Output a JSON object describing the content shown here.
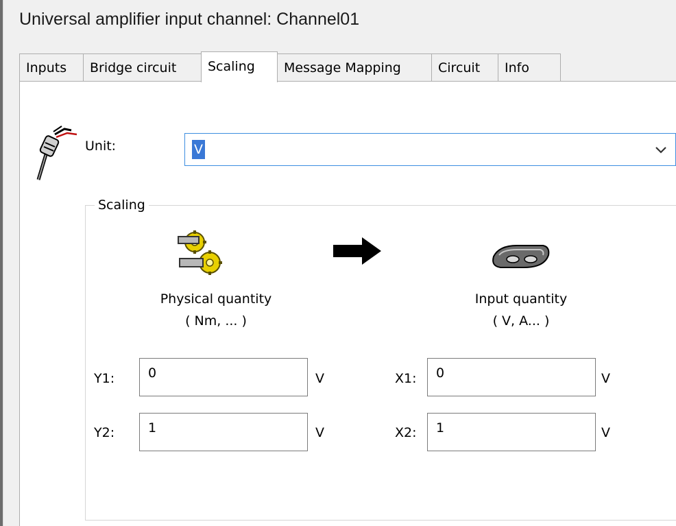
{
  "window": {
    "title": "Universal amplifier input channel: Channel01"
  },
  "tabs": [
    {
      "label": "Inputs"
    },
    {
      "label": "Bridge circuit"
    },
    {
      "label": "Scaling"
    },
    {
      "label": "Message Mapping"
    },
    {
      "label": "Circuit"
    },
    {
      "label": "Info"
    }
  ],
  "active_tab": "Scaling",
  "unit": {
    "label": "Unit:",
    "value": "V"
  },
  "scaling": {
    "group_title": "Scaling",
    "physical": {
      "line1": "Physical quantity",
      "line2": "( Nm, ... )"
    },
    "input": {
      "line1": "Input quantity",
      "line2": "( V, A... )"
    },
    "y1": {
      "label": "Y1:",
      "value": "0",
      "unit": "V"
    },
    "y2": {
      "label": "Y2:",
      "value": "1",
      "unit": "V"
    },
    "x1": {
      "label": "X1:",
      "value": "0",
      "unit": "V"
    },
    "x2": {
      "label": "X2:",
      "value": "1",
      "unit": "V"
    }
  },
  "icons": [
    "probe-icon",
    "gears-icon",
    "arrow-right-icon",
    "device-icon",
    "chevron-down-icon"
  ],
  "colors": {
    "selection": "#3a78d6",
    "focus_border": "#3c8de0",
    "gear_yellow": "#e8d000"
  }
}
